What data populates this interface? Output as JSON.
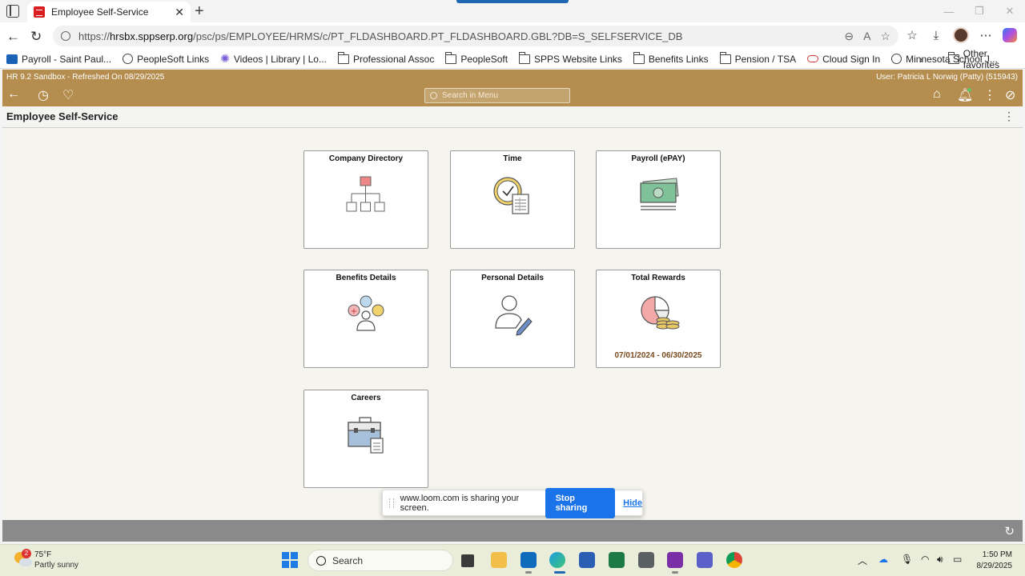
{
  "browser": {
    "tab_title": "Employee Self-Service",
    "url_prefix": "https://",
    "url_host": "hrsbx.sppserp.org",
    "url_path": "/psc/ps/EMPLOYEE/HRMS/c/PT_FLDASHBOARD.PT_FLDASHBOARD.GBL?DB=S_SELFSERVICE_DB",
    "favorites": [
      {
        "label": "Payroll - Saint Paul...",
        "icon": "site-favicon"
      },
      {
        "label": "PeopleSoft Links",
        "icon": "globe-icon"
      },
      {
        "label": "Videos | Library | Lo...",
        "icon": "star-burst-icon"
      },
      {
        "label": "Professional Assoc",
        "icon": "folder-icon"
      },
      {
        "label": "PeopleSoft",
        "icon": "folder-icon"
      },
      {
        "label": "SPPS Website Links",
        "icon": "folder-icon"
      },
      {
        "label": "Benefits Links",
        "icon": "folder-icon"
      },
      {
        "label": "Pension / TSA",
        "icon": "folder-icon"
      },
      {
        "label": "Cloud Sign In",
        "icon": "oracle-icon"
      },
      {
        "label": "Minnesota School J...",
        "icon": "globe-icon"
      }
    ],
    "other_favorites": "Other favorites"
  },
  "ps": {
    "environment": "HR 9.2 Sandbox - Refreshed On 08/29/2025",
    "user": "User: Patricia L Norwig (Patty) (515943)",
    "search_placeholder": "Search in Menu",
    "page_title": "Employee Self-Service"
  },
  "tiles": [
    {
      "title": "Company Directory",
      "icon": "org-chart-icon",
      "sub": ""
    },
    {
      "title": "Time",
      "icon": "clock-timesheet-icon",
      "sub": ""
    },
    {
      "title": "Payroll (ePAY)",
      "icon": "money-icon",
      "sub": ""
    },
    {
      "title": "Benefits Details",
      "icon": "benefits-people-icon",
      "sub": ""
    },
    {
      "title": "Personal Details",
      "icon": "person-edit-icon",
      "sub": ""
    },
    {
      "title": "Total Rewards",
      "icon": "pie-coins-icon",
      "sub": "07/01/2024 - 06/30/2025"
    },
    {
      "title": "Careers",
      "icon": "briefcase-icon",
      "sub": ""
    }
  ],
  "loom": {
    "message": "www.loom.com is sharing your screen.",
    "stop_label": "Stop sharing",
    "hide_label": "Hide"
  },
  "taskbar": {
    "weather_badge": "2",
    "temperature": "75°F",
    "weather_desc": "Partly sunny",
    "search_label": "Search",
    "time": "1:50 PM",
    "date": "8/29/2025"
  },
  "colors": {
    "ps_header": "#b48d4f",
    "accent_blue": "#1a73e8",
    "rewards_date": "#7a4a1e"
  }
}
